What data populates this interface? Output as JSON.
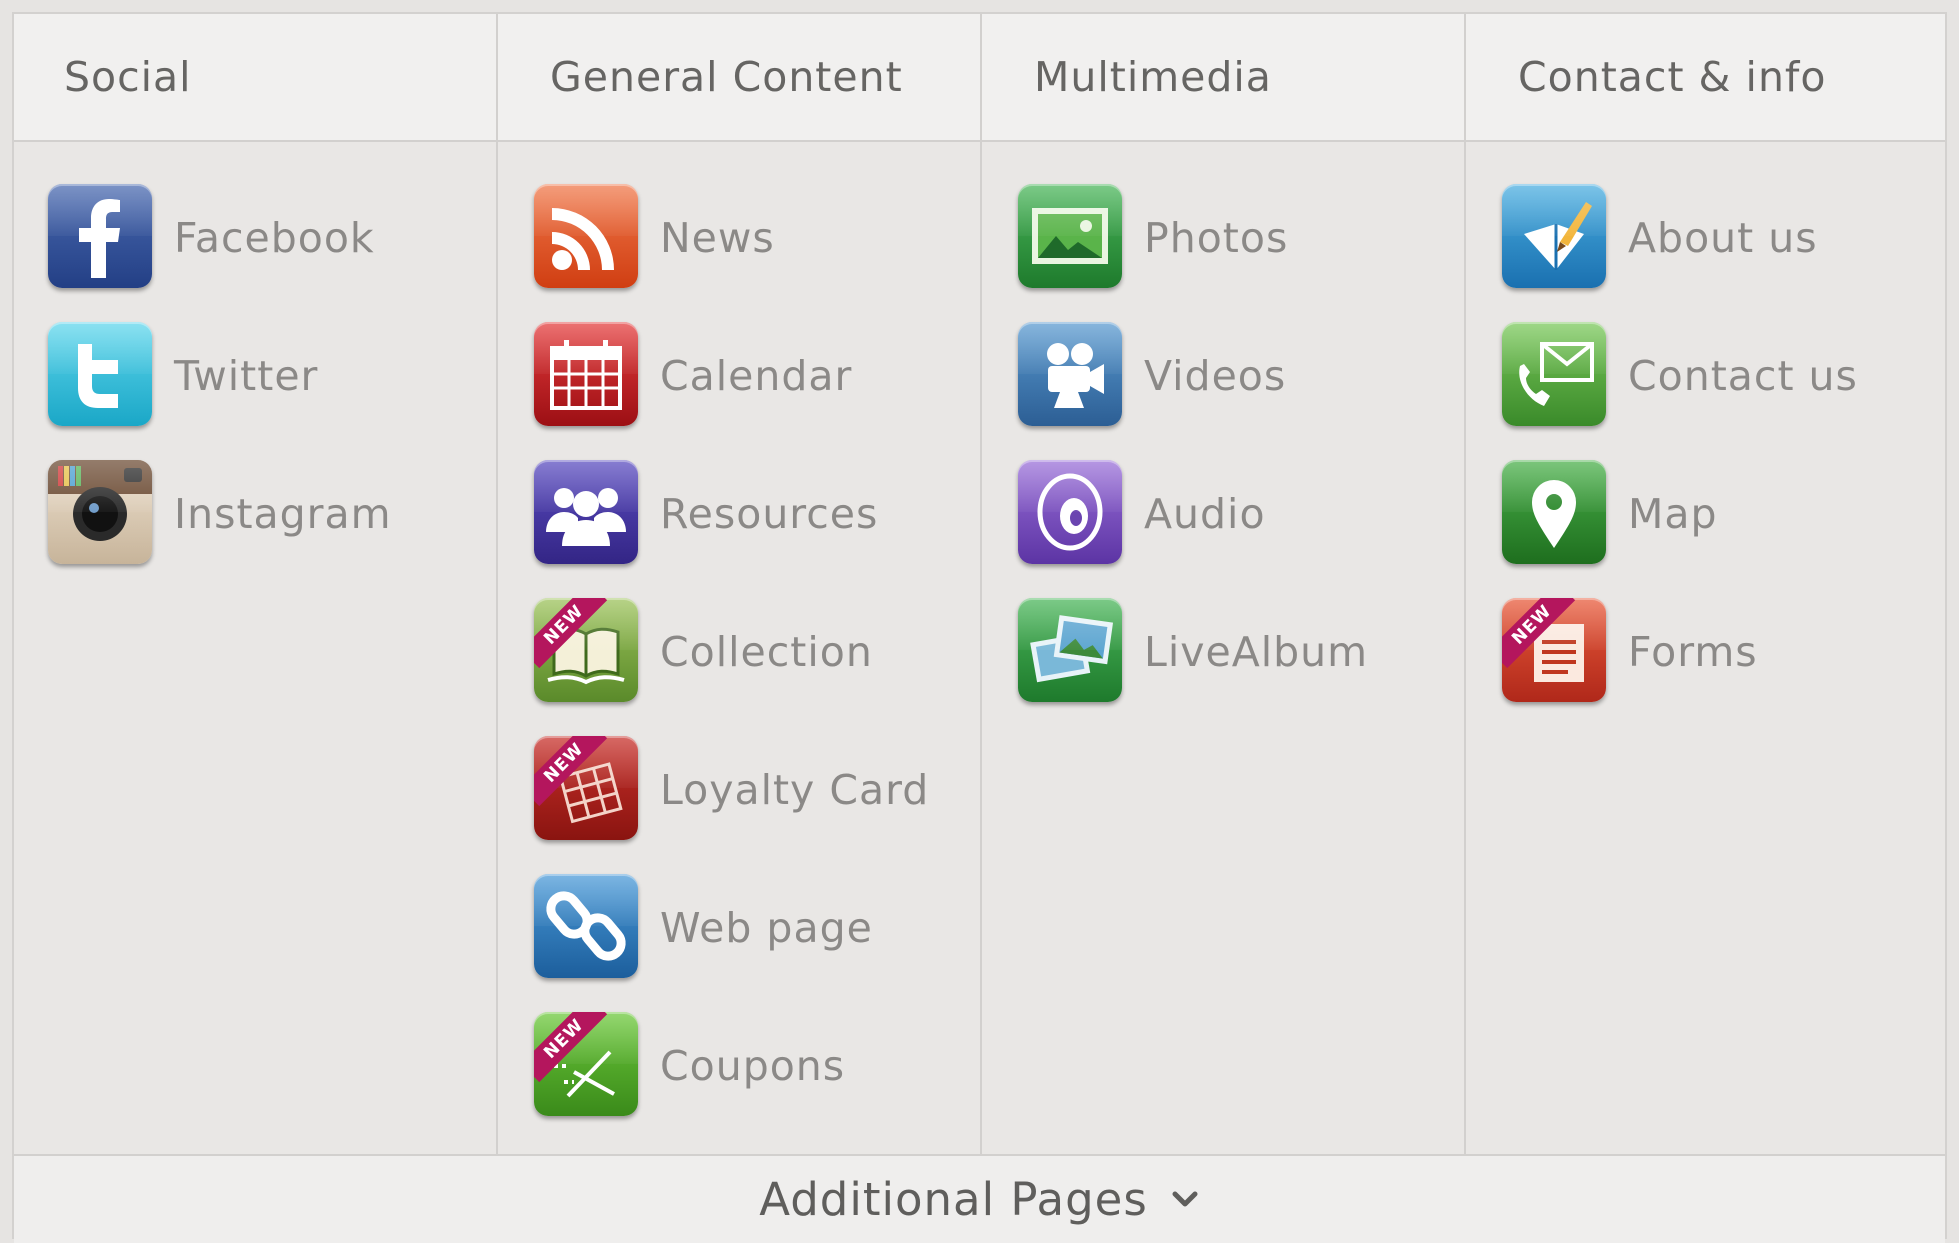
{
  "columns": [
    {
      "title": "Social",
      "items": [
        {
          "label": "Facebook",
          "icon": "facebook-icon"
        },
        {
          "label": "Twitter",
          "icon": "twitter-icon"
        },
        {
          "label": "Instagram",
          "icon": "instagram-icon"
        }
      ]
    },
    {
      "title": "General Content",
      "items": [
        {
          "label": "News",
          "icon": "rss-icon"
        },
        {
          "label": "Calendar",
          "icon": "calendar-icon"
        },
        {
          "label": "Resources",
          "icon": "people-icon"
        },
        {
          "label": "Collection",
          "icon": "book-icon",
          "badge": "NEW"
        },
        {
          "label": "Loyalty Card",
          "icon": "loyalty-card-icon",
          "badge": "NEW"
        },
        {
          "label": "Web page",
          "icon": "link-icon"
        },
        {
          "label": "Coupons",
          "icon": "scissors-icon",
          "badge": "NEW"
        }
      ]
    },
    {
      "title": "Multimedia",
      "items": [
        {
          "label": "Photos",
          "icon": "photo-icon"
        },
        {
          "label": "Videos",
          "icon": "video-camera-icon"
        },
        {
          "label": "Audio",
          "icon": "audio-icon"
        },
        {
          "label": "LiveAlbum",
          "icon": "photo-stack-icon"
        }
      ]
    },
    {
      "title": "Contact & info",
      "items": [
        {
          "label": "About us",
          "icon": "about-book-icon"
        },
        {
          "label": "Contact us",
          "icon": "phone-mail-icon"
        },
        {
          "label": "Map",
          "icon": "map-pin-icon"
        },
        {
          "label": "Forms",
          "icon": "form-icon",
          "badge": "NEW"
        }
      ]
    }
  ],
  "footer": {
    "label": "Additional Pages",
    "icon": "chevron-down-icon"
  },
  "colors": {
    "background": "#e9e7e5",
    "header": "#f1f0ef",
    "label": "#8b8987",
    "new_badge": "#b4165d"
  }
}
